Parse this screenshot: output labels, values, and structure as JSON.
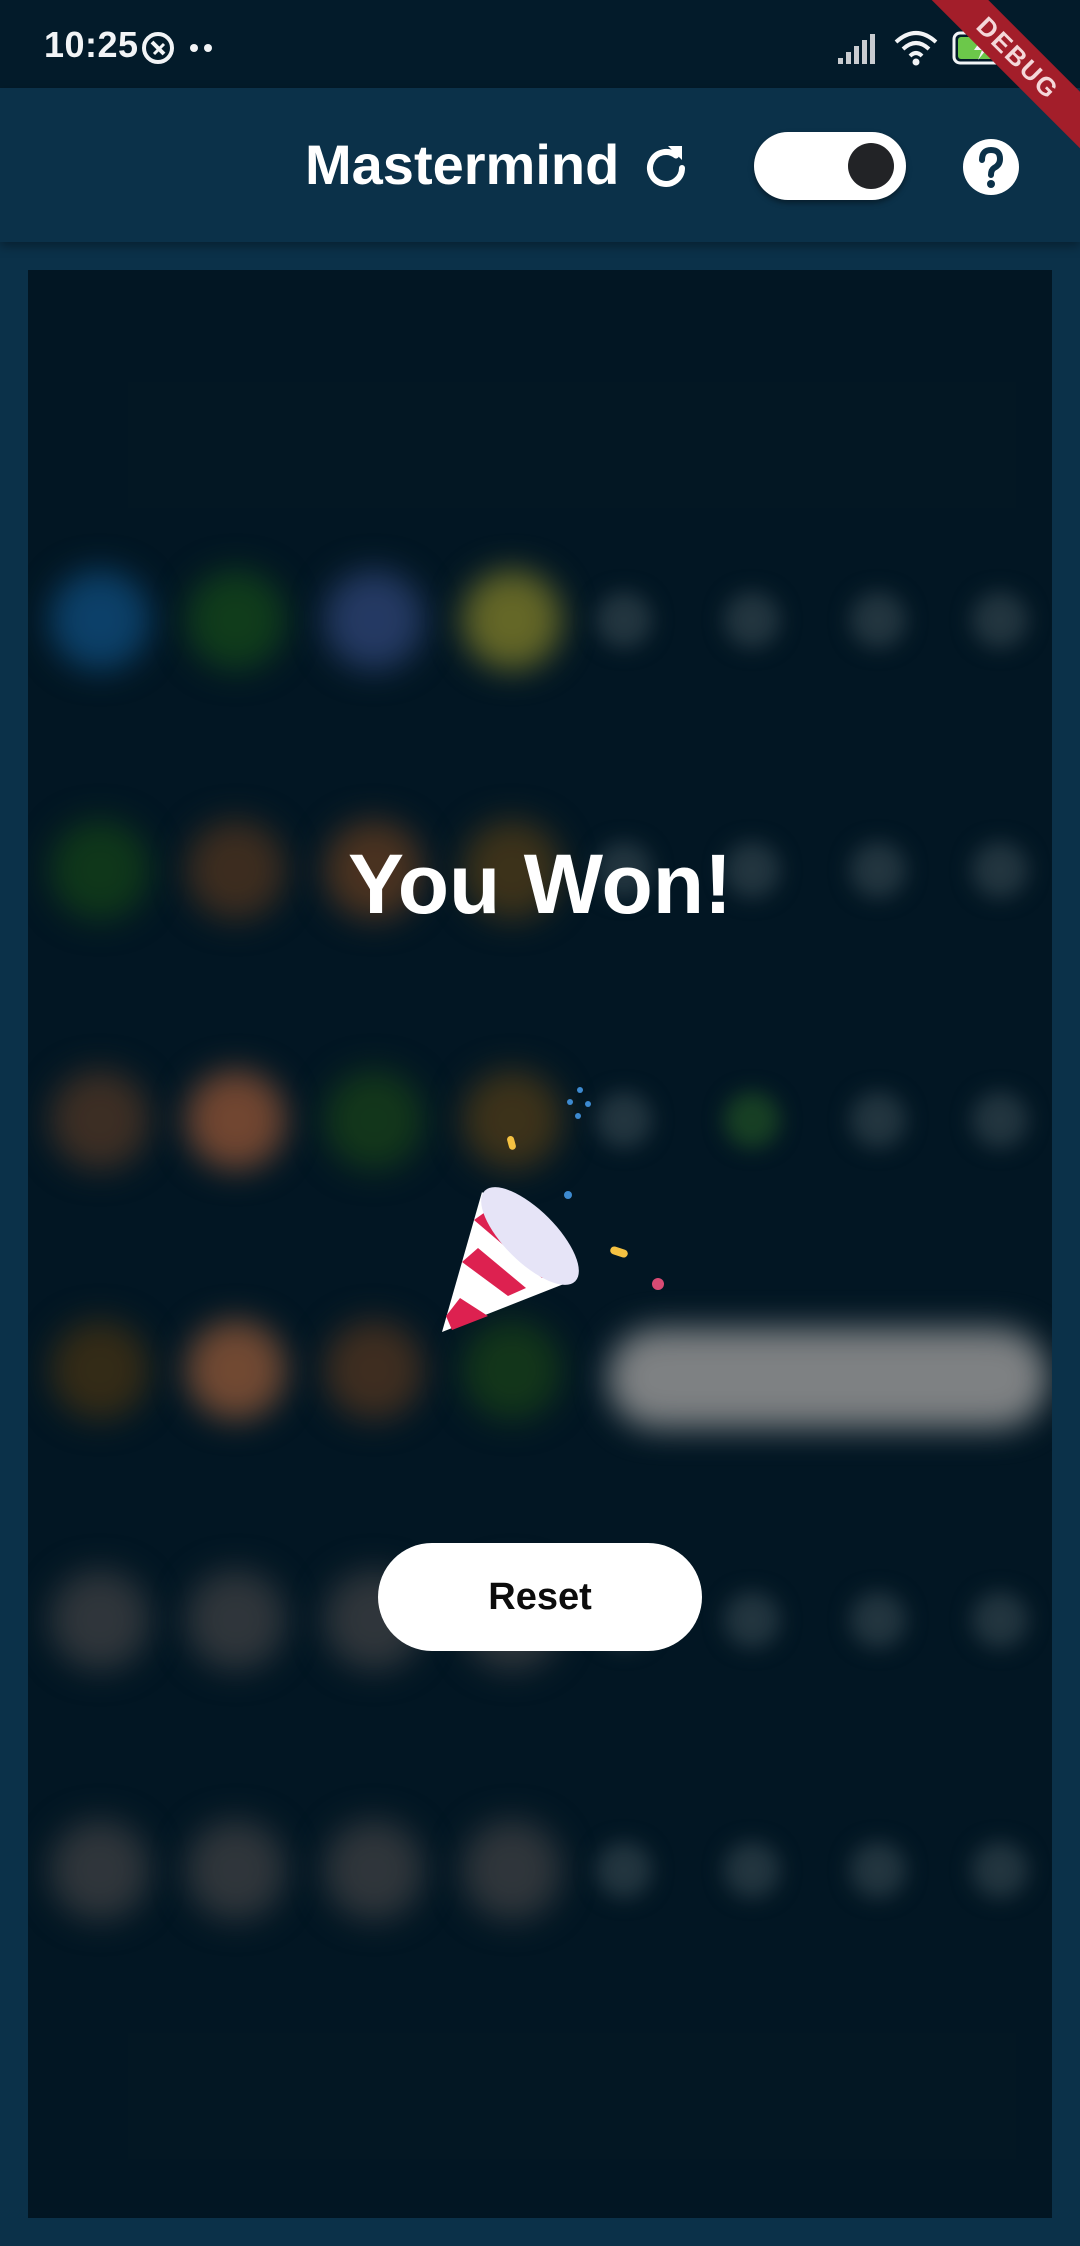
{
  "status_bar": {
    "time": "10:25"
  },
  "app_bar": {
    "title": "Mastermind",
    "refresh_icon": "refresh-icon",
    "theme_toggle_on": true,
    "help_icon": "help-icon"
  },
  "debug_banner": "DEBUG",
  "overlay": {
    "message": "You Won!",
    "emoji": "party-popper-icon",
    "reset_label": "Reset"
  },
  "colors": {
    "background": "#0b3149",
    "board": "#031825",
    "button": "#ffffff",
    "debug_ribbon": "#a31e2a"
  }
}
